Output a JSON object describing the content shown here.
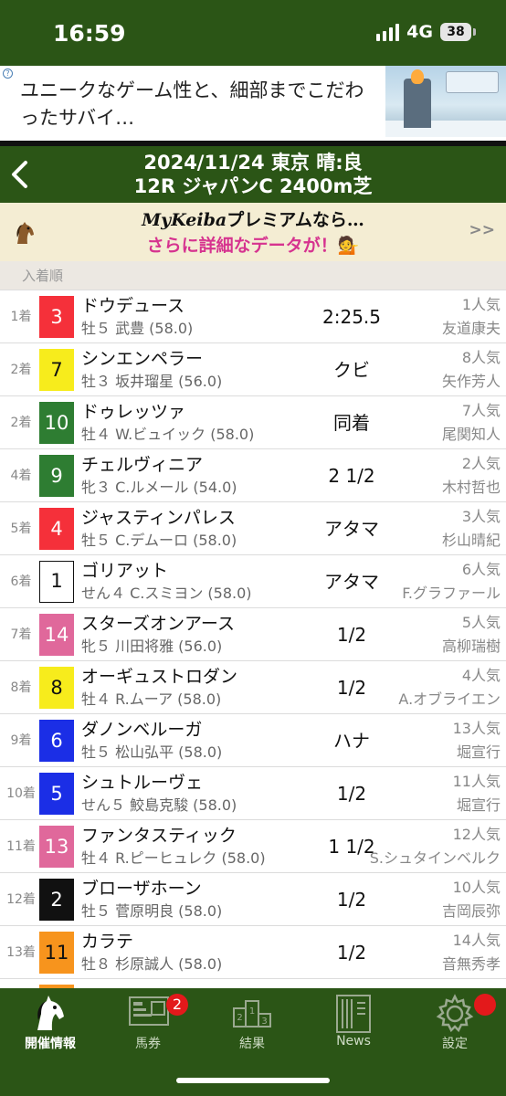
{
  "status_bar": {
    "time": "16:59",
    "network": "4G",
    "battery": "38"
  },
  "ad": {
    "text": "ユニークなゲーム性と、細部までこだわったサバイ…"
  },
  "header": {
    "line1": "2024/11/24 東京 晴:良",
    "line2": "12R ジャパンC 2400m芝"
  },
  "promo": {
    "brand": "MyKeiba",
    "line1_rest": "プレミアムなら…",
    "line2": "さらに詳細なデータが！💁",
    "more": ">>"
  },
  "section_label": "入着順",
  "results": [
    {
      "rank": "1着",
      "gate": "3",
      "gate_bg": "#f5303a",
      "gate_fg": "#ffffff",
      "horse": "ドウデュース",
      "info": "牡５ 武豊 (58.0)",
      "margin": "2:25.5",
      "popularity": "1人気",
      "trainer": "友道康夫"
    },
    {
      "rank": "2着",
      "gate": "7",
      "gate_bg": "#f7ec1c",
      "gate_fg": "#111111",
      "horse": "シンエンペラー",
      "info": "牡３ 坂井瑠星 (56.0)",
      "margin": "クビ",
      "popularity": "8人気",
      "trainer": "矢作芳人"
    },
    {
      "rank": "2着",
      "gate": "10",
      "gate_bg": "#2e7d32",
      "gate_fg": "#ffffff",
      "horse": "ドゥレッツァ",
      "info": "牡４ W.ビュイック (58.0)",
      "margin": "同着",
      "popularity": "7人気",
      "trainer": "尾関知人"
    },
    {
      "rank": "4着",
      "gate": "9",
      "gate_bg": "#2e7d32",
      "gate_fg": "#ffffff",
      "horse": "チェルヴィニア",
      "info": "牝３ C.ルメール (54.0)",
      "margin": "2 1/2",
      "popularity": "2人気",
      "trainer": "木村哲也"
    },
    {
      "rank": "5着",
      "gate": "4",
      "gate_bg": "#f5303a",
      "gate_fg": "#ffffff",
      "horse": "ジャスティンパレス",
      "info": "牡５ C.デムーロ (58.0)",
      "margin": "アタマ",
      "popularity": "3人気",
      "trainer": "杉山晴紀"
    },
    {
      "rank": "6着",
      "gate": "1",
      "gate_bg": "#ffffff",
      "gate_fg": "#111111",
      "horse": "ゴリアット",
      "info": "せん４ C.スミヨン (58.0)",
      "margin": "アタマ",
      "popularity": "6人気",
      "trainer": "F.グラファール"
    },
    {
      "rank": "7着",
      "gate": "14",
      "gate_bg": "#e0689b",
      "gate_fg": "#ffffff",
      "horse": "スターズオンアース",
      "info": "牝５ 川田将雅 (56.0)",
      "margin": "1/2",
      "popularity": "5人気",
      "trainer": "高柳瑞樹"
    },
    {
      "rank": "8着",
      "gate": "8",
      "gate_bg": "#f7ec1c",
      "gate_fg": "#111111",
      "horse": "オーギュストロダン",
      "info": "牡４ R.ムーア (58.0)",
      "margin": "1/2",
      "popularity": "4人気",
      "trainer": "A.オブライエン"
    },
    {
      "rank": "9着",
      "gate": "6",
      "gate_bg": "#1b2ee6",
      "gate_fg": "#ffffff",
      "horse": "ダノンベルーガ",
      "info": "牡５ 松山弘平 (58.0)",
      "margin": "ハナ",
      "popularity": "13人気",
      "trainer": "堀宣行"
    },
    {
      "rank": "10着",
      "gate": "5",
      "gate_bg": "#1b2ee6",
      "gate_fg": "#ffffff",
      "horse": "シュトルーヴェ",
      "info": "せん５ 鮫島克駿 (58.0)",
      "margin": "1/2",
      "popularity": "11人気",
      "trainer": "堀宣行"
    },
    {
      "rank": "11着",
      "gate": "13",
      "gate_bg": "#e0689b",
      "gate_fg": "#ffffff",
      "horse": "ファンタスティック",
      "info": "牡４ R.ピーヒュレク (58.0)",
      "margin": "1 1/2",
      "popularity": "12人気",
      "trainer": "S.シュタインベルク"
    },
    {
      "rank": "12着",
      "gate": "2",
      "gate_bg": "#111111",
      "gate_fg": "#ffffff",
      "horse": "ブローザホーン",
      "info": "牡５ 菅原明良 (58.0)",
      "margin": "1/2",
      "popularity": "10人気",
      "trainer": "吉岡辰弥"
    },
    {
      "rank": "13着",
      "gate": "11",
      "gate_bg": "#f7941d",
      "gate_fg": "#111111",
      "horse": "カラテ",
      "info": "牡８ 杉原誠人 (58.0)",
      "margin": "1/2",
      "popularity": "14人気",
      "trainer": "音無秀孝"
    },
    {
      "rank": "",
      "gate": "",
      "gate_bg": "#f7941d",
      "gate_fg": "#111111",
      "horse": "",
      "info": "",
      "margin": "",
      "popularity": "",
      "trainer": ""
    }
  ],
  "tabs": [
    {
      "label": "開催情報",
      "icon": "horse-head-icon",
      "active": true
    },
    {
      "label": "馬券",
      "icon": "ticket-icon",
      "badge": "2"
    },
    {
      "label": "結果",
      "icon": "podium-icon"
    },
    {
      "label": "News",
      "icon": "news-icon"
    },
    {
      "label": "設定",
      "icon": "gear-icon",
      "dot": true
    }
  ]
}
